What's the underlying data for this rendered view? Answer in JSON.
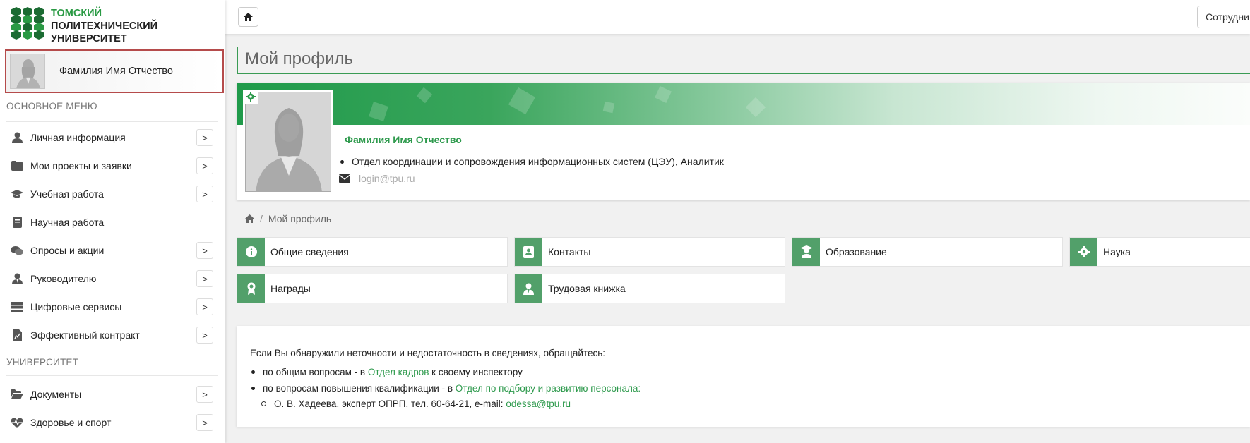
{
  "brand": {
    "line1": "ТОМСКИЙ",
    "line2": "ПОЛИТЕХНИЧЕСКИЙ",
    "line3": "УНИВЕРСИТЕТ",
    "accent": "#2a9a44",
    "dark": "#1b6b32"
  },
  "user": {
    "name": "Фамилия Имя Отчество"
  },
  "sidebar": {
    "section_main": "ОСНОВНОЕ МЕНЮ",
    "main_items": [
      {
        "label": "Личная информация",
        "icon": "user-icon",
        "has_chevron": true
      },
      {
        "label": "Мои проекты и заявки",
        "icon": "folder-icon",
        "has_chevron": true
      },
      {
        "label": "Учебная работа",
        "icon": "graduation-cap-icon",
        "has_chevron": true
      },
      {
        "label": "Научная работа",
        "icon": "book-icon",
        "has_chevron": false
      },
      {
        "label": "Опросы и акции",
        "icon": "chat-icon",
        "has_chevron": true
      },
      {
        "label": "Руководителю",
        "icon": "user-tie-icon",
        "has_chevron": true
      },
      {
        "label": "Цифровые сервисы",
        "icon": "server-icon",
        "has_chevron": true
      },
      {
        "label": "Эффективный контракт",
        "icon": "document-chart-icon",
        "has_chevron": true
      }
    ],
    "section_university": "УНИВЕРСИТЕТ",
    "university_items": [
      {
        "label": "Документы",
        "icon": "folder-open-icon",
        "has_chevron": true
      },
      {
        "label": "Здоровье и спорт",
        "icon": "heartbeat-icon",
        "has_chevron": true
      }
    ],
    "chevron": ">"
  },
  "topbar": {
    "staff_button": "Сотрудни"
  },
  "page": {
    "title": "Мой профиль"
  },
  "profile": {
    "name": "Фамилия Имя Отчество",
    "position": "Отдел координации и сопровождения информационных систем (ЦЭУ), Аналитик",
    "email": "login@tpu.ru"
  },
  "breadcrumb": {
    "current": "Мой профиль",
    "separator": "/"
  },
  "tiles": [
    {
      "label": "Общие сведения",
      "icon": "info-icon"
    },
    {
      "label": "Контакты",
      "icon": "contact-book-icon"
    },
    {
      "label": "Образование",
      "icon": "graduate-icon"
    },
    {
      "label": "Наука",
      "icon": "gear-icon"
    },
    {
      "label": "Награды",
      "icon": "award-icon"
    },
    {
      "label": "Трудовая книжка",
      "icon": "worker-icon"
    }
  ],
  "info": {
    "intro": "Если Вы обнаружили неточности и недостаточность в сведениях, обращайтесь:",
    "item1_prefix": "по общим вопросам - в ",
    "item1_link": "Отдел кадров",
    "item1_suffix": " к своему инспектору",
    "item2_prefix": "по вопросам повышения квалификации - в ",
    "item2_link": "Отдел по подбору и развитию персонала",
    "item2_suffix": ":",
    "sub_prefix": "О. В. Хадеева, эксперт ОПРП, тел. 60-64-21, e-mail: ",
    "sub_link": "odessa@tpu.ru"
  },
  "colors": {
    "tile_icon_bg": "#52a06a",
    "link": "#2e9a4d",
    "highlight_border": "#b54b4b"
  }
}
